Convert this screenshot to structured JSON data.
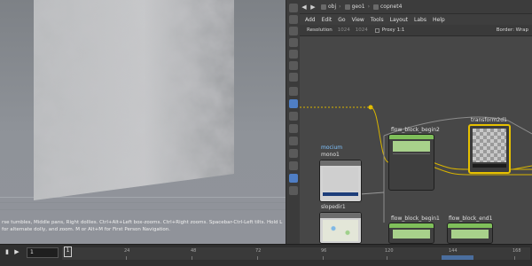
{
  "network": {
    "back": "◀",
    "forward": "▶",
    "path": [
      {
        "label": "obj"
      },
      {
        "label": "geo1"
      },
      {
        "label": "copnet4"
      }
    ]
  },
  "menu": [
    "Add",
    "Edit",
    "Go",
    "View",
    "Tools",
    "Layout",
    "Labs",
    "Help"
  ],
  "options": {
    "resolution_label": "Resolution",
    "res_w": "1024",
    "res_h": "1024",
    "proxy": "Proxy 1:1",
    "border": "Border: Wrap"
  },
  "nodes": {
    "mono_type": "mocium",
    "mono_name": "mono1",
    "sloped_name": "slopedir1",
    "flow_begin2": "flow_block_begin2",
    "flow_begin1": "flow_block_begin1",
    "flow_end1": "flow_block_end1",
    "transform": "transform2d1"
  },
  "viewport": {
    "help": "rse tumbles, Middle pans, Right dollies. Ctrl+Alt+Left box-zooms. Ctrl+Right zooms. Spacebar-Ctrl-Left tilts. Hold L for alternate dolly, and zoom. M or Alt+M for First Person Navigation."
  },
  "timeline": {
    "frame": "1",
    "current": "1",
    "ticks": [
      "24",
      "48",
      "72",
      "96",
      "120",
      "144",
      "168"
    ]
  },
  "colors": {
    "accent_blue": "#4f7ec4",
    "selection_yellow": "#e6c000",
    "wire_yellow": "#d8b400"
  }
}
